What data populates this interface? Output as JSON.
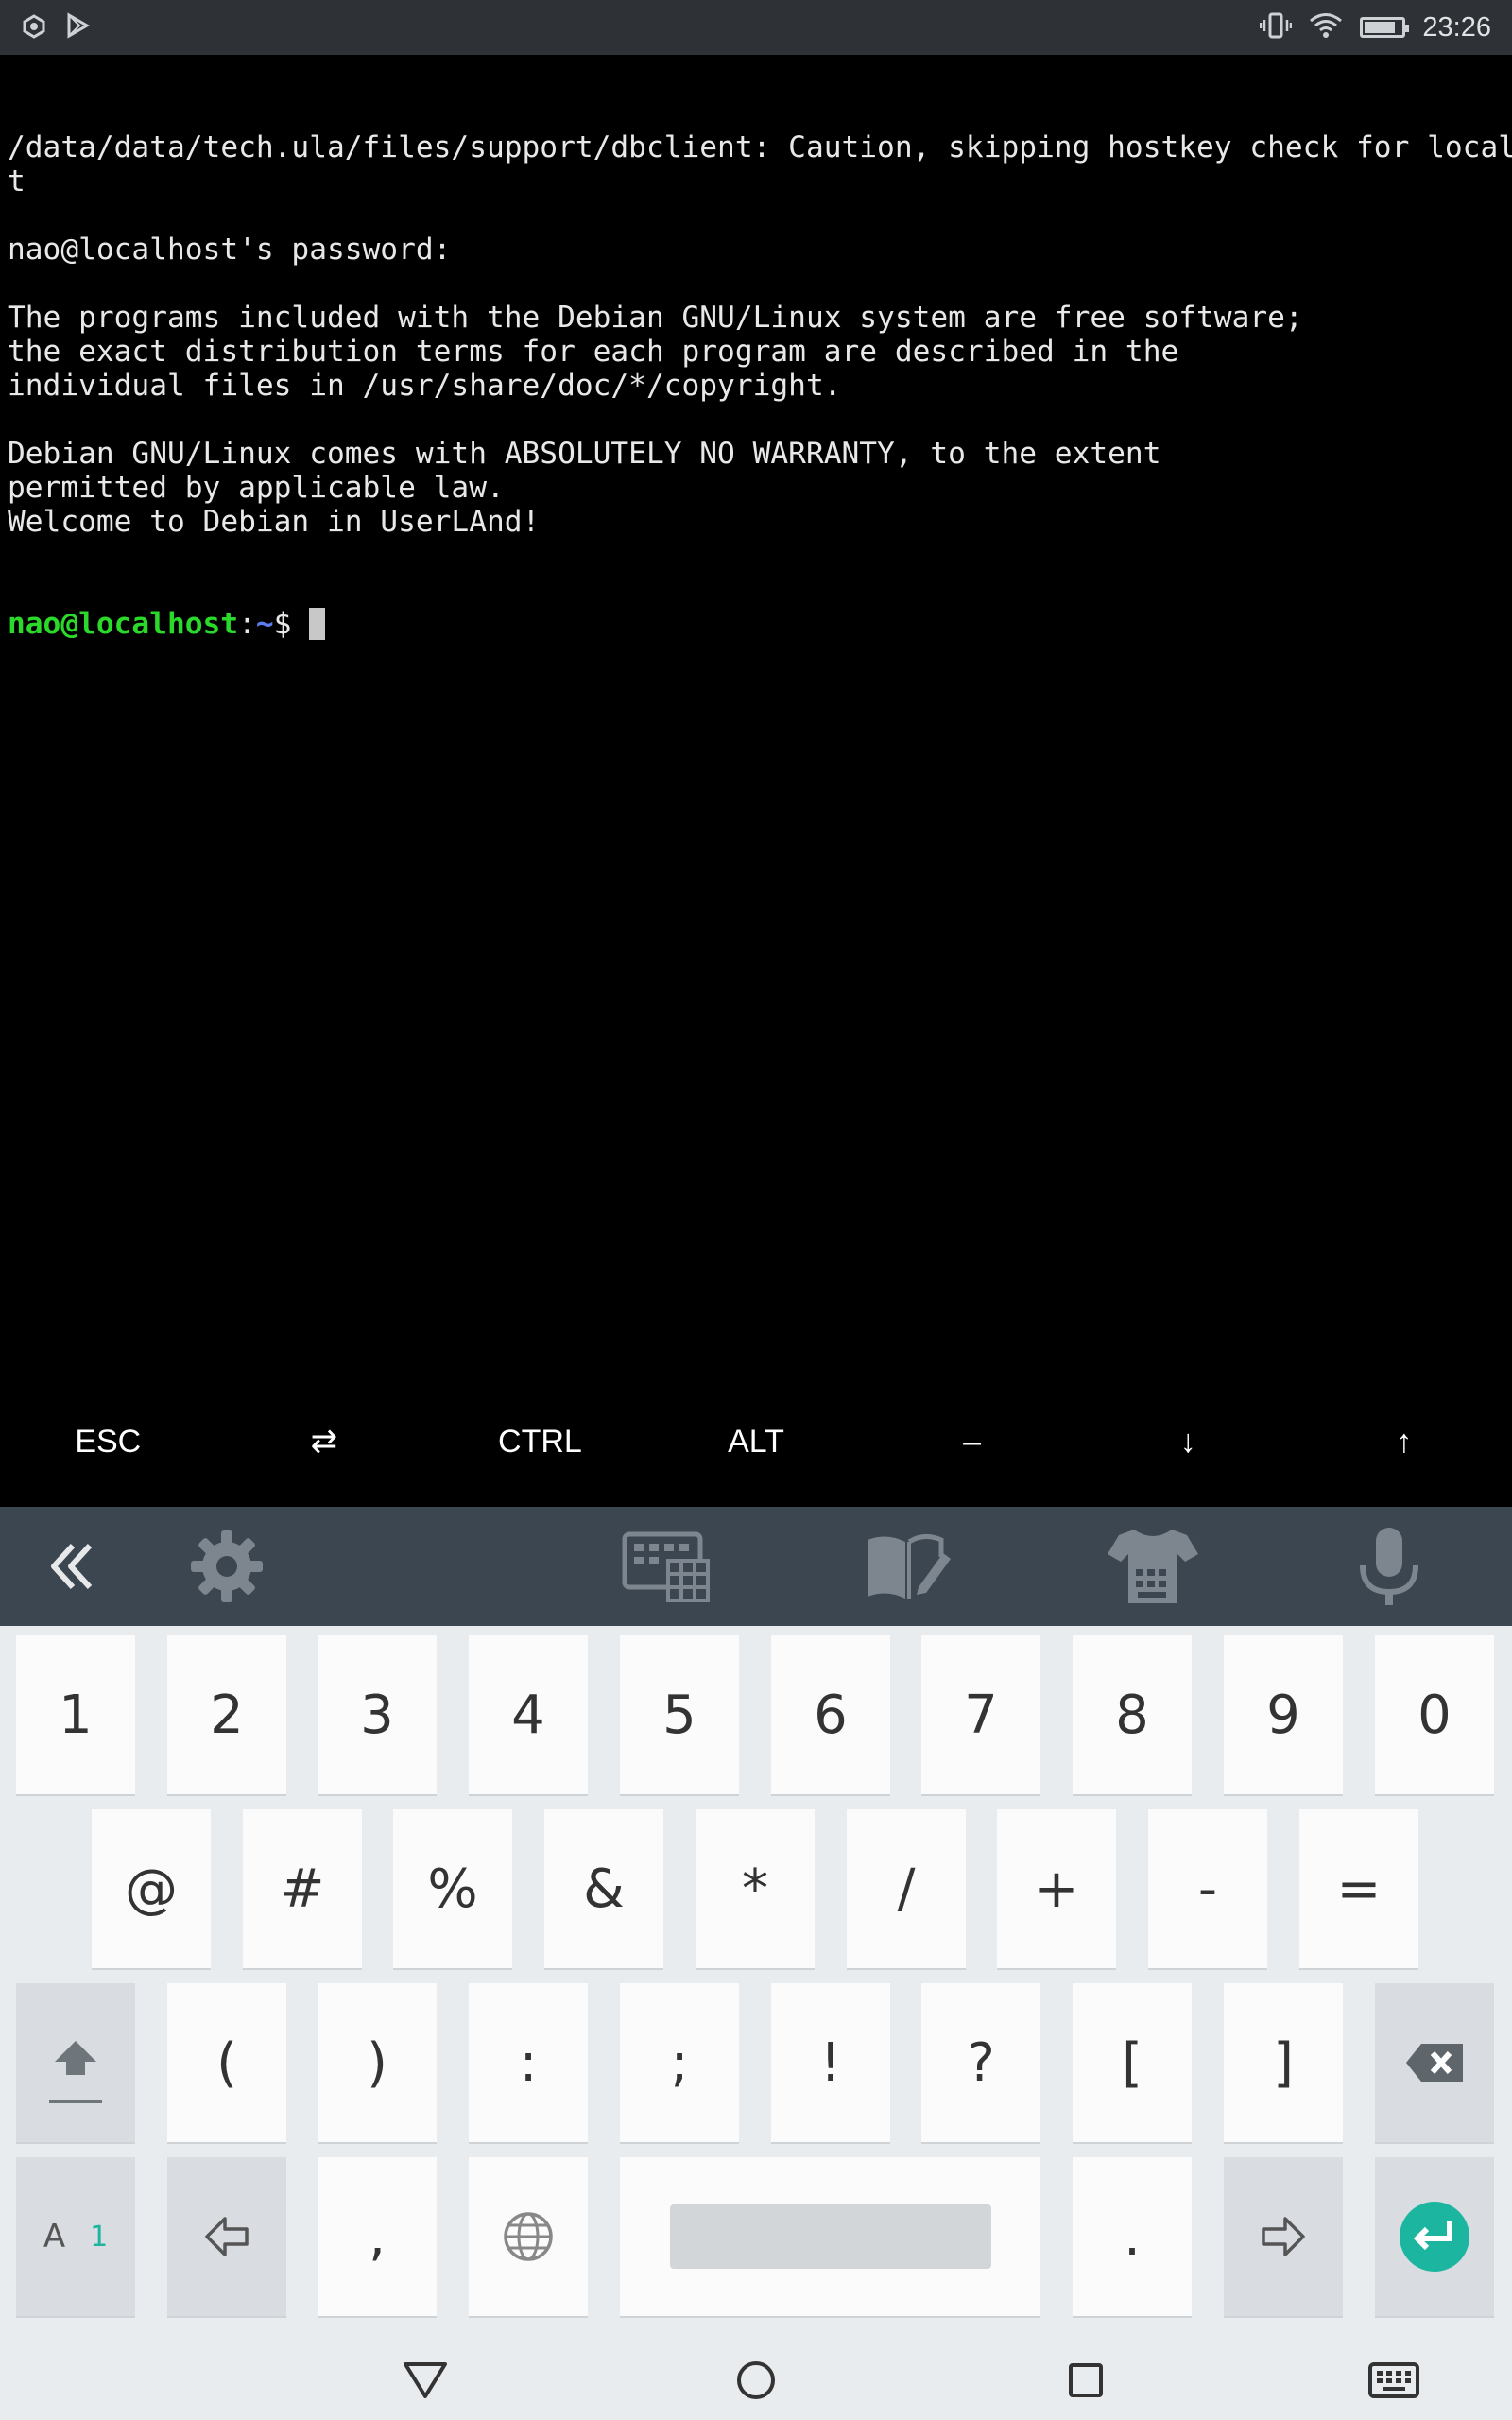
{
  "status_bar": {
    "time": "23:26",
    "left_icons": [
      "android-debug-icon",
      "play-store-icon"
    ],
    "right_icons": [
      "vibrate-icon",
      "wifi-icon",
      "battery-icon"
    ],
    "battery_level": 0.85
  },
  "terminal": {
    "lines": [
      "/data/data/tech.ula/files/support/dbclient: Caution, skipping hostkey check for localhos",
      "t",
      "",
      "nao@localhost's password:",
      "",
      "The programs included with the Debian GNU/Linux system are free software;",
      "the exact distribution terms for each program are described in the",
      "individual files in /usr/share/doc/*/copyright.",
      "",
      "Debian GNU/Linux comes with ABSOLUTELY NO WARRANTY, to the extent",
      "permitted by applicable law.",
      "Welcome to Debian in UserLAnd!"
    ],
    "prompt_user": "nao@localhost",
    "prompt_sep": ":",
    "prompt_path": "~",
    "prompt_symbol": "$ "
  },
  "extra_keys": [
    "ESC",
    "⇄",
    "CTRL",
    "ALT",
    "–",
    "↓",
    "↑"
  ],
  "keyboard_toolbar": {
    "icons": [
      "collapse-icon",
      "settings-icon",
      "keyboard-layout-icon",
      "clipboard-edit-icon",
      "theme-icon",
      "microphone-icon"
    ]
  },
  "keyboard": {
    "row1": [
      "1",
      "2",
      "3",
      "4",
      "5",
      "6",
      "7",
      "8",
      "9",
      "0"
    ],
    "row2": [
      "@",
      "#",
      "%",
      "&",
      "*",
      "/",
      "+",
      "-",
      "="
    ],
    "row3": [
      "(",
      ")",
      ":",
      ";",
      "!",
      "?",
      "[",
      "]"
    ],
    "row4": {
      "mode_label": "A",
      "mode_sub": "1",
      "comma": ",",
      "period": "."
    },
    "colors": {
      "accent": "#1bb5a0",
      "key_bg": "#fbfbfb",
      "dark_key_bg": "#d9dde1"
    }
  },
  "nav_bar": {
    "buttons": [
      "back-icon",
      "home-icon",
      "recents-icon",
      "keyboard-switch-icon"
    ]
  }
}
